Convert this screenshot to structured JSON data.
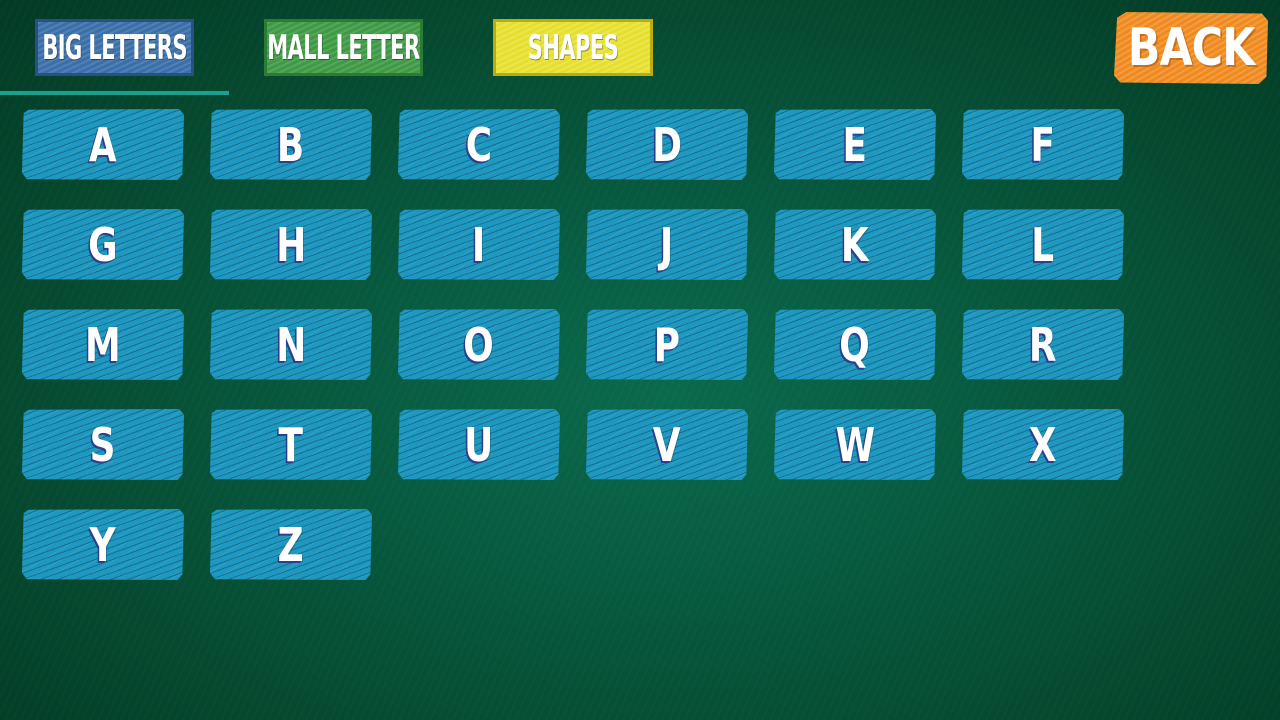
{
  "tabs": {
    "big_letters": "BIG LETTERS",
    "small_letters": "SMALL LETTERS",
    "shapes": "SHAPES"
  },
  "active_tab": "BIG LETTERS",
  "back_button": {
    "label": "BACK"
  },
  "letters": [
    "A",
    "B",
    "C",
    "D",
    "E",
    "F",
    "G",
    "H",
    "I",
    "J",
    "K",
    "L",
    "M",
    "N",
    "O",
    "P",
    "Q",
    "R",
    "S",
    "T",
    "U",
    "V",
    "W",
    "X",
    "Y",
    "Z"
  ],
  "colors": {
    "board": "#075a3f",
    "tile": "#1e98c0",
    "big_letters_tab": "#3a6fa8",
    "small_letters_tab": "#3f9a45",
    "shapes_tab": "#e6df2b",
    "back_button": "#f08a1e",
    "active_underline": "#1aa08e"
  }
}
